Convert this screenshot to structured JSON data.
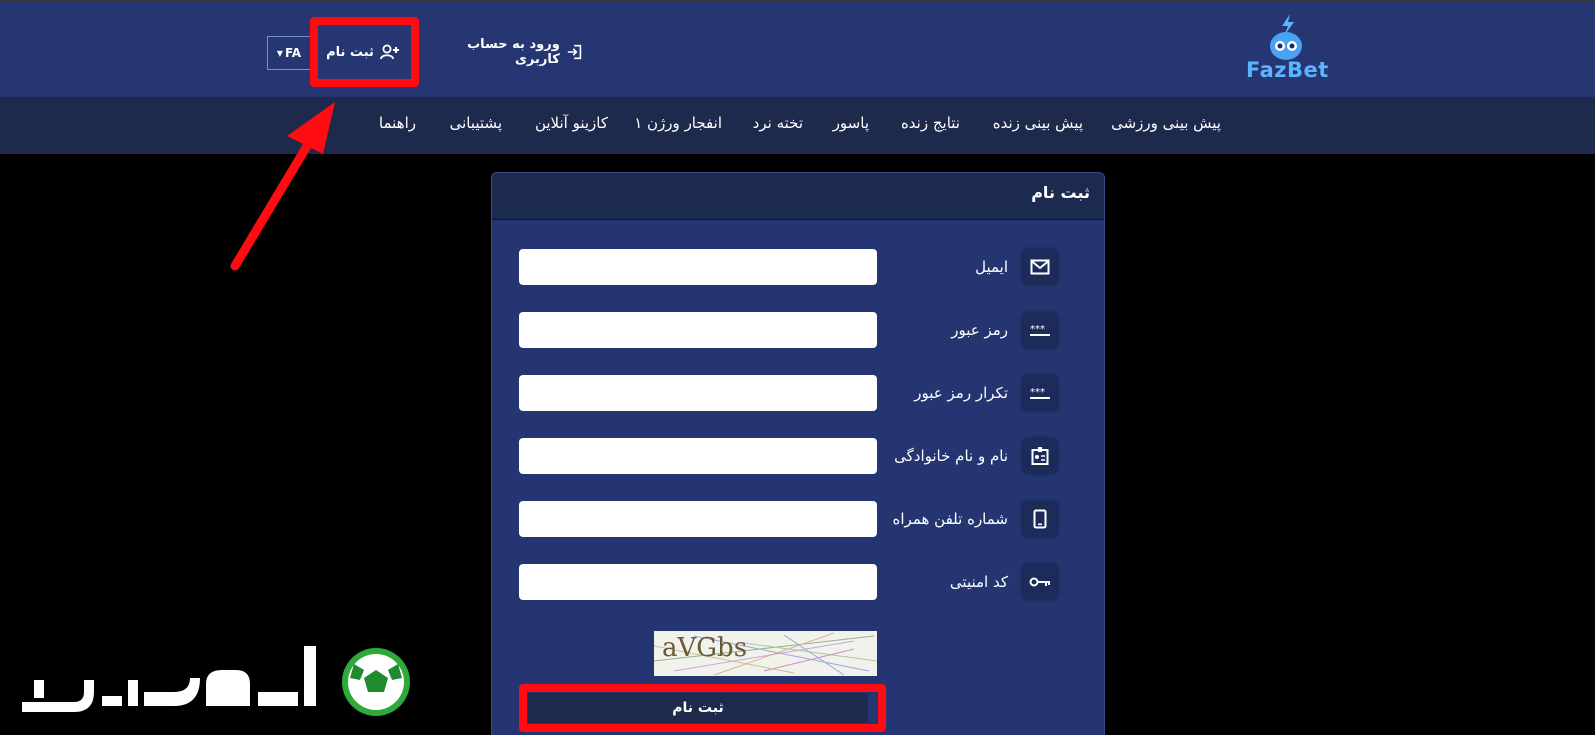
{
  "header": {
    "logo_text": "FazBet",
    "lang": "FA",
    "register_label": "ثبت نام",
    "login_label": "ورود به حساب کاربری"
  },
  "nav": {
    "items": [
      "پیش بینی ورزشی",
      "پیش بینی زنده",
      "نتایج زنده",
      "پاسور",
      "تخته نرد",
      "انفجار ورژن ۱",
      "کازینو آنلاین",
      "پشتیبانی",
      "راهنما"
    ]
  },
  "form": {
    "title": "ثبت نام",
    "fields": [
      {
        "label": "ایمیل",
        "icon": "envelope-icon",
        "value": ""
      },
      {
        "label": "رمز عبور",
        "icon": "password-icon",
        "value": ""
      },
      {
        "label": "تکرار رمز عبور",
        "icon": "password-icon",
        "value": ""
      },
      {
        "label": "نام و نام خانوادگی",
        "icon": "id-card-icon",
        "value": ""
      },
      {
        "label": "شماره تلفن همراه",
        "icon": "mobile-icon",
        "value": ""
      },
      {
        "label": "کد امنیتی",
        "icon": "key-icon",
        "value": ""
      }
    ],
    "captcha_text": "aVGbs",
    "submit_label": "ثبت نام"
  },
  "colors": {
    "topbar": "#253672",
    "navbar": "#1e2a4b",
    "card": "#243571",
    "highlight": "#ff0b12"
  }
}
